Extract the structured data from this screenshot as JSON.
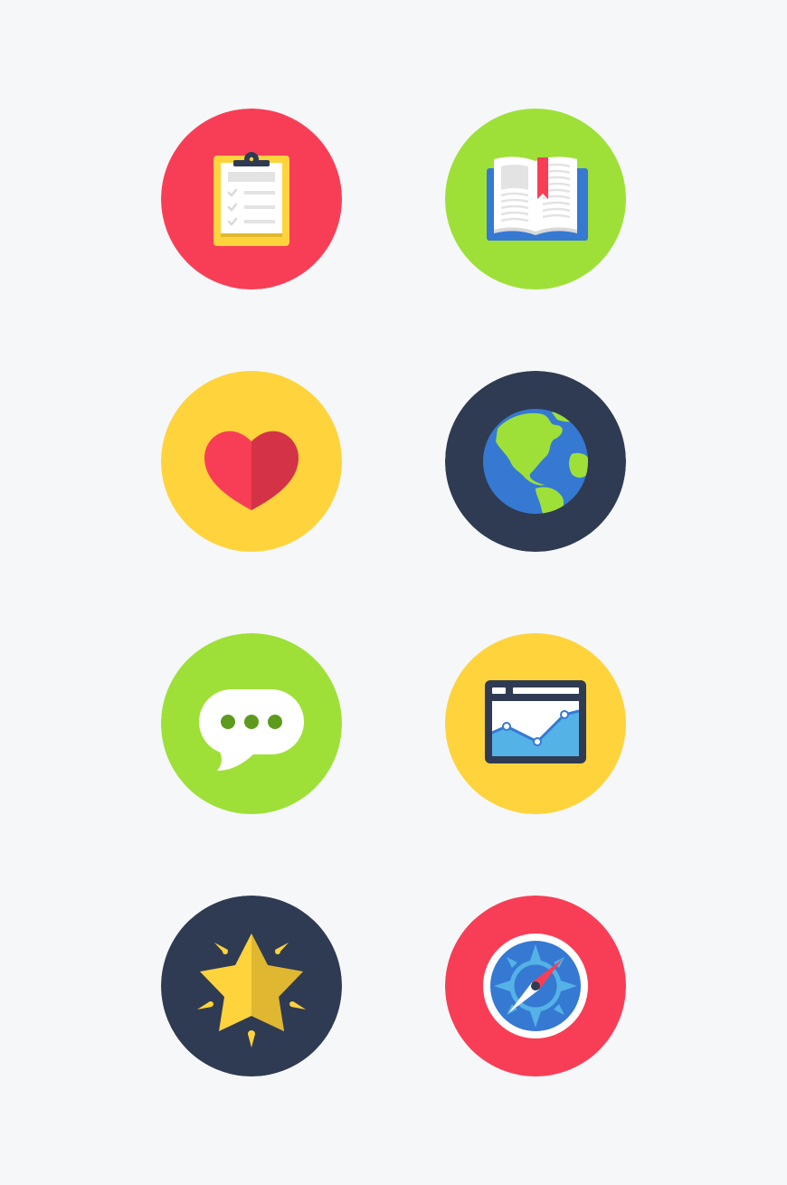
{
  "colors": {
    "page_background": "#f5f7f9",
    "red": "#f83e56",
    "green": "#9ee037",
    "yellow": "#ffd33c",
    "navy": "#2f3b52",
    "blue": "#3579d3",
    "light_blue": "#54b2e6",
    "white": "#ffffff"
  },
  "icons": [
    {
      "name": "clipboard-icon",
      "background": "#f83e56"
    },
    {
      "name": "book-icon",
      "background": "#9ee037"
    },
    {
      "name": "heart-icon",
      "background": "#ffd33c"
    },
    {
      "name": "globe-icon",
      "background": "#2f3b52"
    },
    {
      "name": "chat-bubble-icon",
      "background": "#9ee037"
    },
    {
      "name": "line-chart-icon",
      "background": "#ffd33c"
    },
    {
      "name": "star-icon",
      "background": "#2f3b52"
    },
    {
      "name": "compass-icon",
      "background": "#f83e56"
    }
  ]
}
